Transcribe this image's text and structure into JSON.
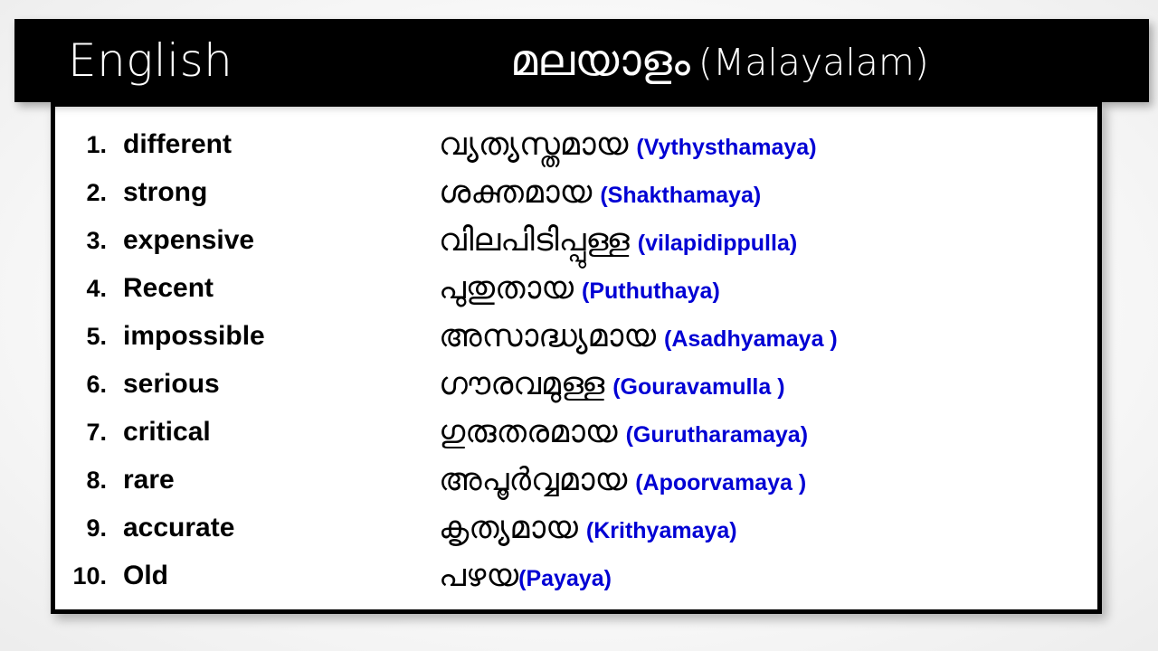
{
  "header": {
    "left_label": "English",
    "right_native": "മലയാളം",
    "right_roman": "(Malayalam)"
  },
  "colors": {
    "header_background": "#000000",
    "header_text": "#ffffff",
    "body_background": "#ffffff",
    "border": "#000000",
    "english_text": "#000000",
    "malayalam_text": "#000000",
    "transliteration_text": "#0000d4",
    "page_background": "#f2f2f2"
  },
  "table": {
    "columns": [
      "English",
      "മലയാളം (Malayalam)"
    ],
    "rows": [
      {
        "num": "1.",
        "english": "different",
        "malayalam": "വ്യത്യസ്തമായ",
        "translit": "(Vythysthamaya)",
        "spaced": true
      },
      {
        "num": "2.",
        "english": "strong",
        "malayalam": "ശക്തമായ",
        "translit": "(Shakthamaya)",
        "spaced": true
      },
      {
        "num": "3.",
        "english": "expensive",
        "malayalam": "വിലപിടിപ്പുള്ള",
        "translit": "(vilapidippulla)",
        "spaced": true
      },
      {
        "num": "4.",
        "english": "Recent",
        "malayalam": "പുതുതായ",
        "translit": "(Puthuthaya)",
        "spaced": true
      },
      {
        "num": "5.",
        "english": "impossible",
        "malayalam": "അസാദ്ധ്യമായ",
        "translit": "(Asadhyamaya )",
        "spaced": true
      },
      {
        "num": "6.",
        "english": "serious",
        "malayalam": "ഗൗരവമുള്ള",
        "translit": "(Gouravamulla )",
        "spaced": true
      },
      {
        "num": "7.",
        "english": "critical",
        "malayalam": "ഗുരുതരമായ",
        "translit": "(Gurutharamaya)",
        "spaced": true
      },
      {
        "num": "8.",
        "english": "rare",
        "malayalam": "അപൂർവ്വമായ",
        "translit": "(Apoorvamaya )",
        "spaced": true
      },
      {
        "num": "9.",
        "english": "accurate",
        "malayalam": "കൃത്യമായ",
        "translit": "(Krithyamaya)",
        "spaced": true
      },
      {
        "num": "10.",
        "english": "Old",
        "malayalam": "പഴയ",
        "translit": "(Payaya)",
        "spaced": false
      }
    ]
  }
}
